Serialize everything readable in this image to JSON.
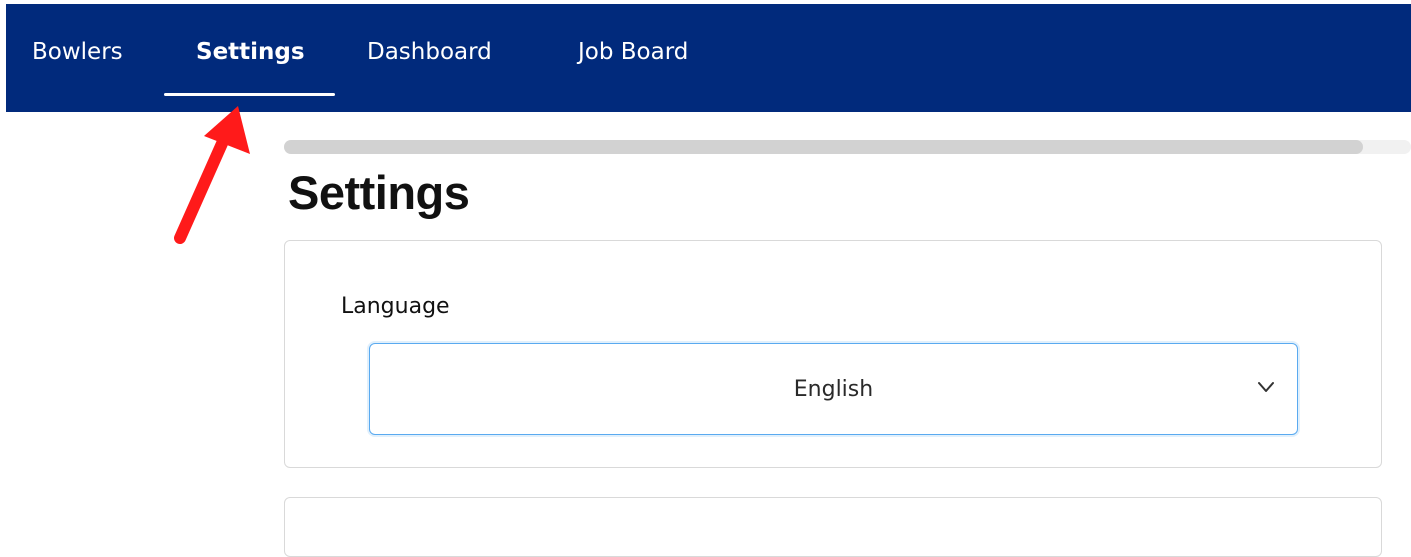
{
  "nav": {
    "items": [
      {
        "label": "Bowlers",
        "active": false
      },
      {
        "label": "Settings",
        "active": true
      },
      {
        "label": "Dashboard",
        "active": false
      },
      {
        "label": "Job Board",
        "active": false
      }
    ]
  },
  "progress": {
    "fraction": 0.957
  },
  "page": {
    "title": "Settings"
  },
  "language": {
    "label": "Language",
    "selected": "English"
  },
  "colors": {
    "nav_bg": "#012a7c",
    "accent_focus": "#5aaaf0",
    "annotation_arrow": "#ff1a1a"
  },
  "icons": {
    "dropdown": "chevron-down-icon",
    "annotation": "red-arrow-icon"
  }
}
